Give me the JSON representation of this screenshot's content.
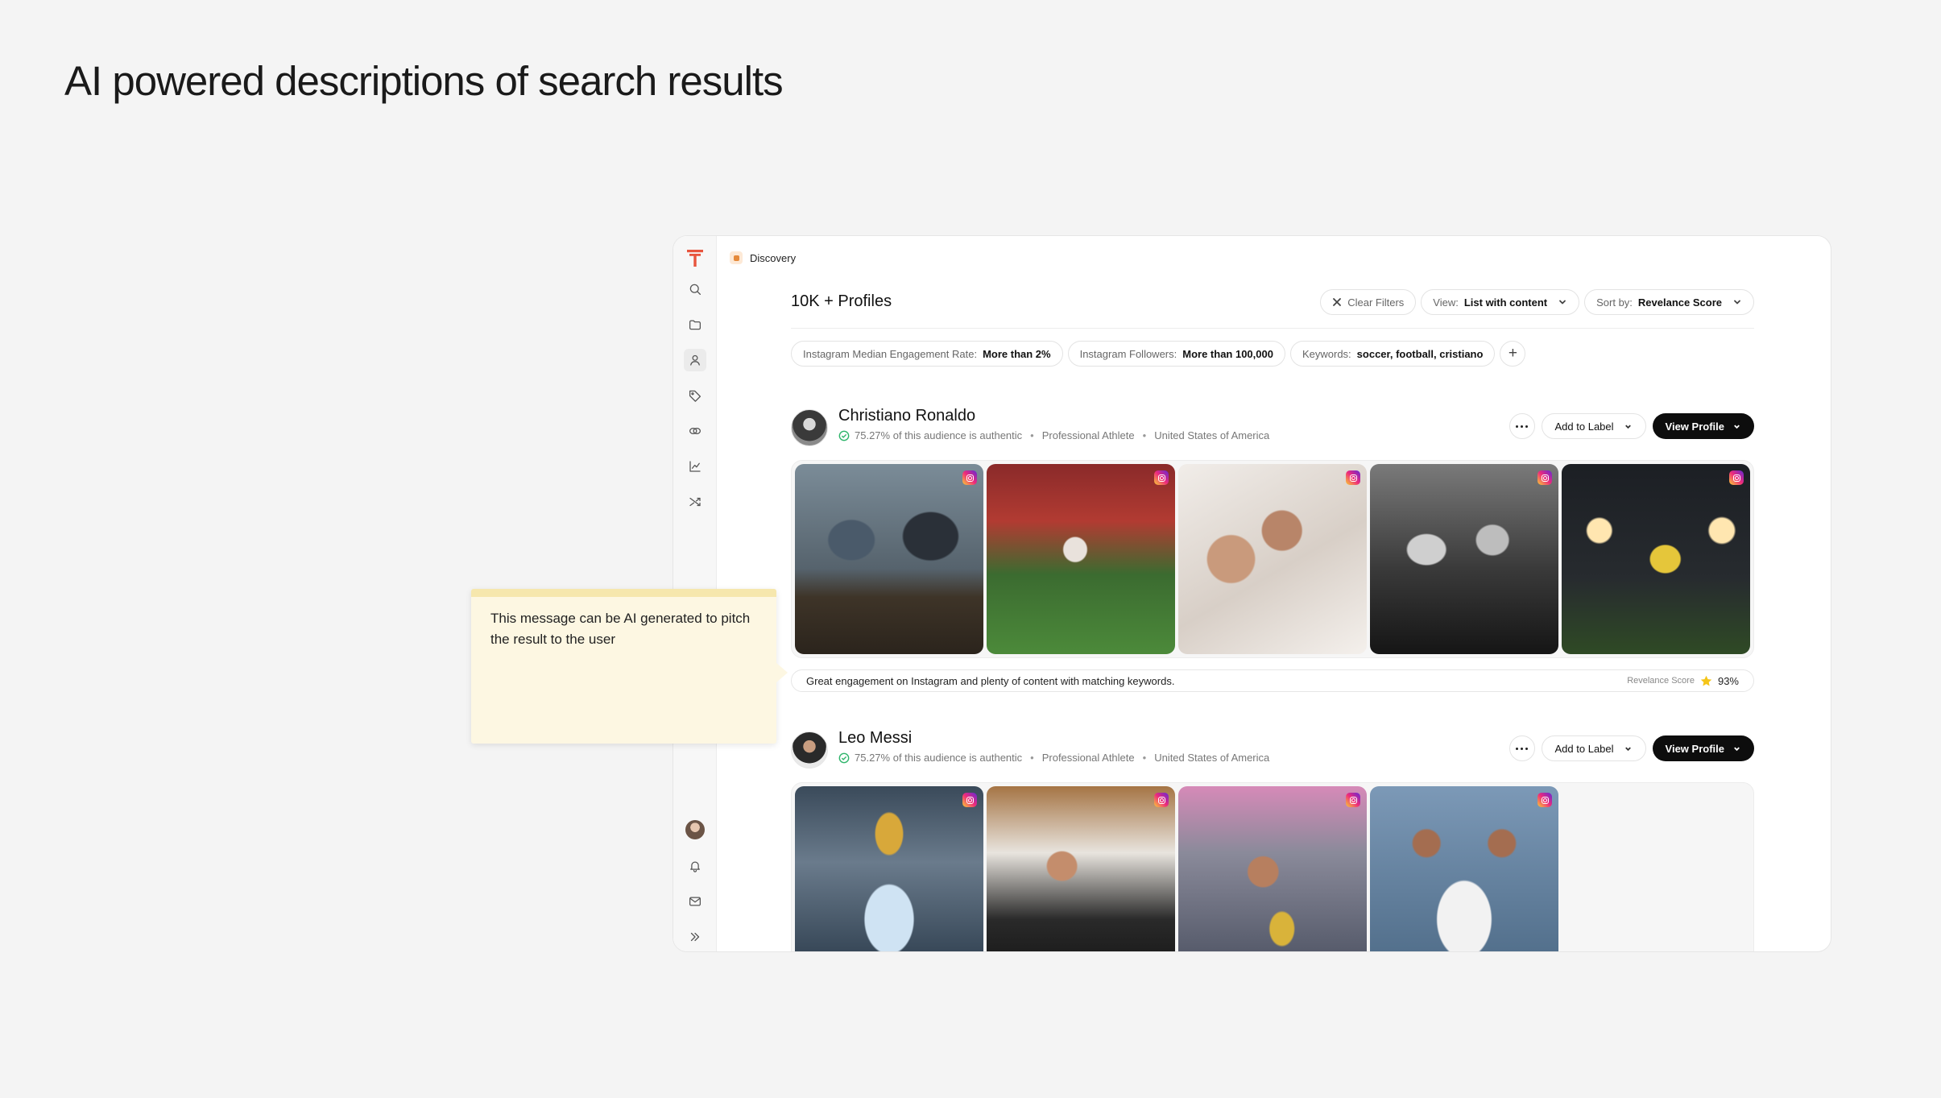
{
  "headline": "AI powered descriptions of search results",
  "breadcrumb": "Discovery",
  "results_count": "10K + Profiles",
  "controls": {
    "clear_filters": "Clear Filters",
    "view_label": "View:",
    "view_value": "List with content",
    "sort_label": "Sort by:",
    "sort_value": "Revelance Score"
  },
  "filters": [
    {
      "label": "Instagram Median Engagement Rate:",
      "value": "More than 2%"
    },
    {
      "label": "Instagram Followers:",
      "value": "More than 100,000"
    },
    {
      "label": "Keywords:",
      "value": "soccer, football,  cristiano"
    }
  ],
  "add_filter": "+",
  "actions": {
    "add_to_label": "Add to Label",
    "view_profile": "View Profile"
  },
  "profiles": [
    {
      "name": "Christiano Ronaldo",
      "authentic_pct": "75.27%",
      "authentic_text": "of this audience is authentic",
      "category": "Professional Athlete",
      "country": "United States of America",
      "ai_description": "Great engagement on Instagram and plenty of content with matching keywords.",
      "score_label": "Revelance Score",
      "score_value": "93%"
    },
    {
      "name": "Leo Messi",
      "authentic_pct": "75.27%",
      "authentic_text": "of this audience is authentic",
      "category": "Professional Athlete",
      "country": "United States of America"
    }
  ],
  "note": "This message can be AI generated to pitch the result to the user",
  "icons": [
    "app-logo-icon",
    "search-icon",
    "folder-icon",
    "user-icon",
    "tag-icon",
    "link-icon",
    "chart-icon",
    "shuffle-icon",
    "bell-icon",
    "mail-icon",
    "chevrons-right-icon",
    "instagram-icon",
    "verified-check-icon",
    "star-icon",
    "close-icon",
    "chevron-down-icon",
    "more-icon"
  ],
  "colors": {
    "brand": "#e8553e",
    "accent_dark": "#0d0d0d",
    "note_bg": "#fdf7e2",
    "verified": "#2fb56b",
    "star": "#f5c518"
  }
}
